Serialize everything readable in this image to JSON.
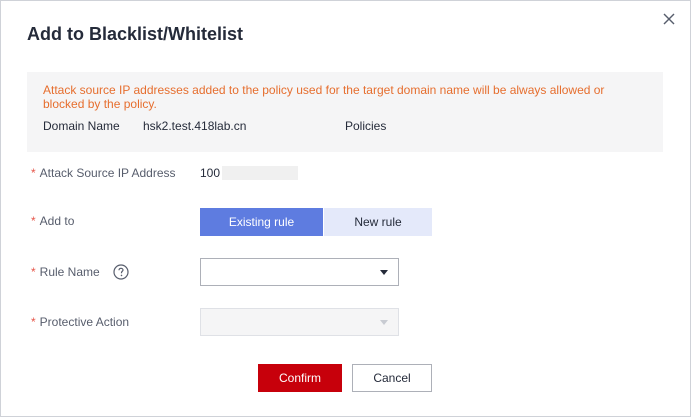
{
  "dialog": {
    "title": "Add to Blacklist/Whitelist",
    "close_icon": "close-icon"
  },
  "notice": {
    "text": "Attack source IP addresses added to the policy used for the target domain name will be always allowed or blocked by the policy.",
    "domain_label": "Domain Name",
    "domain_value": "hsk2.test.418lab.cn",
    "policies_label": "Policies"
  },
  "form": {
    "required_mark": "*",
    "ip": {
      "label": "Attack Source IP Address",
      "value": "100"
    },
    "add_to": {
      "label": "Add to",
      "options": [
        "Existing rule",
        "New rule"
      ],
      "selected": "Existing rule"
    },
    "rule_name": {
      "label": "Rule Name",
      "help_icon": "question-circle-icon",
      "value": ""
    },
    "protective_action": {
      "label": "Protective Action",
      "value": "",
      "disabled": true
    }
  },
  "footer": {
    "confirm_label": "Confirm",
    "cancel_label": "Cancel"
  },
  "colors": {
    "primary": "#5e7ce0",
    "danger": "#c7000b",
    "warning_text": "#e66e2e",
    "required": "#e6564a"
  }
}
